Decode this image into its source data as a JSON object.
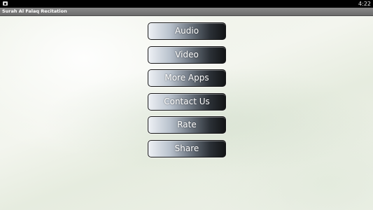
{
  "status_bar": {
    "time": "4:22",
    "notification_icon": "android-notification-icon"
  },
  "title_bar": {
    "title": "Surah Al Falaq Recitation"
  },
  "menu": {
    "buttons": [
      {
        "id": "audio",
        "label": "Audio"
      },
      {
        "id": "video",
        "label": "Video"
      },
      {
        "id": "more-apps",
        "label": "More Apps"
      },
      {
        "id": "contact-us",
        "label": "Contact Us"
      },
      {
        "id": "rate",
        "label": "Rate"
      },
      {
        "id": "share",
        "label": "Share"
      }
    ]
  },
  "colors": {
    "status_bar_bg": "#000000",
    "title_bar_bg": "#7a7a7a",
    "button_dark": "#121416",
    "button_light": "#eef1f5",
    "background": "#eef2e8"
  }
}
